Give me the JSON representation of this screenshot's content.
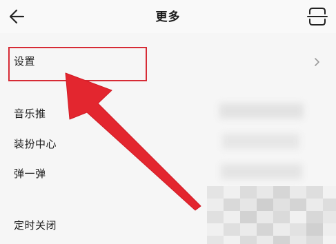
{
  "header": {
    "title": "更多",
    "back_icon": "back-arrow-icon",
    "scan_icon": "scan-icon"
  },
  "items": [
    {
      "label": "设置"
    },
    {
      "label": "音乐推"
    },
    {
      "label": "装扮中心"
    },
    {
      "label": "弹一弹"
    },
    {
      "label": "定时关闭"
    }
  ],
  "colors": {
    "highlight": "#d62b35",
    "arrow": "#e3262f",
    "background": "#f6f6f6"
  }
}
